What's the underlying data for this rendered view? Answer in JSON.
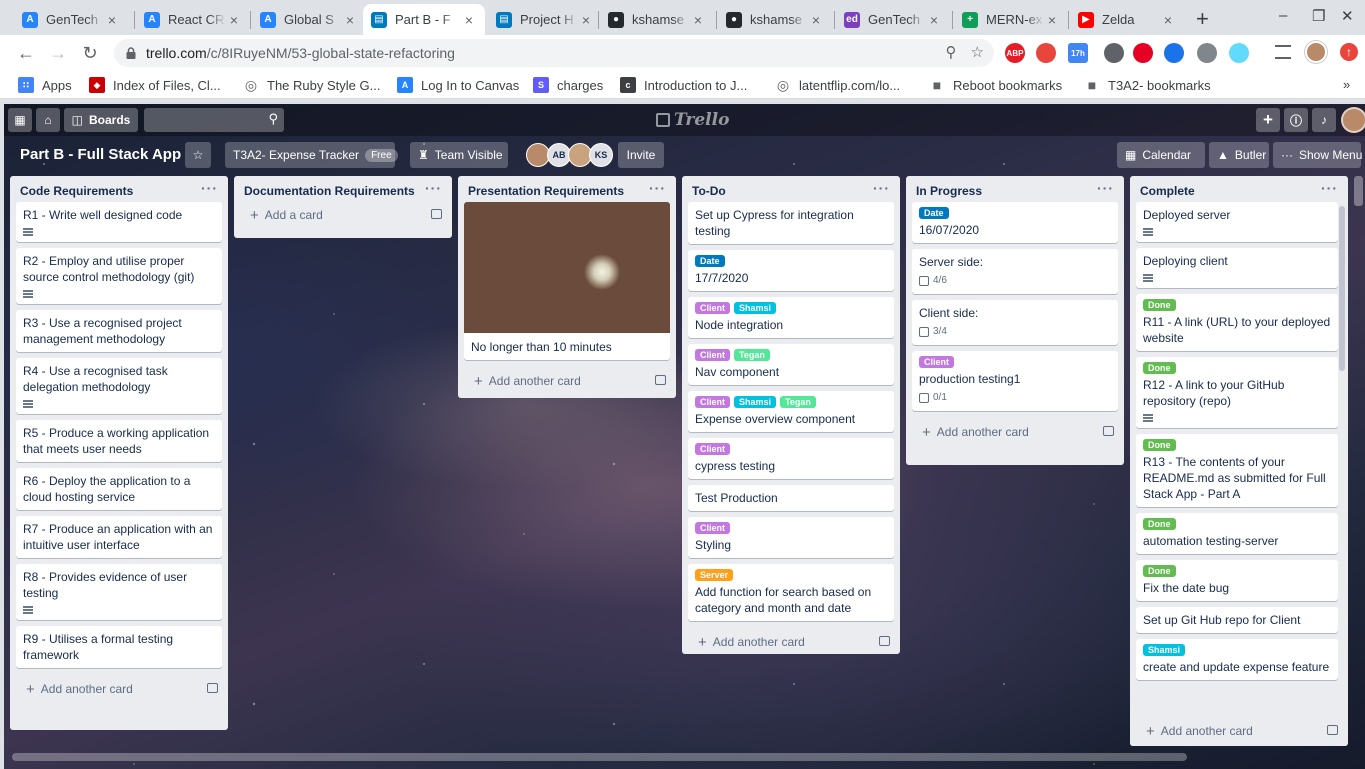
{
  "browser": {
    "tabs": [
      {
        "title": "GenTech",
        "icon": "atlassian-icon",
        "active": false
      },
      {
        "title": "React CR",
        "icon": "atlassian-icon",
        "active": false
      },
      {
        "title": "Global S",
        "icon": "atlassian-icon",
        "active": false
      },
      {
        "title": "Part B - F",
        "icon": "trello-icon",
        "active": true
      },
      {
        "title": "Project H",
        "icon": "trello-icon",
        "active": false
      },
      {
        "title": "kshamse",
        "icon": "github-icon",
        "active": false
      },
      {
        "title": "kshamse",
        "icon": "github-icon",
        "active": false
      },
      {
        "title": "GenTech",
        "icon": "ed-icon",
        "active": false
      },
      {
        "title": "MERN-ex",
        "icon": "sheets-icon",
        "active": false
      },
      {
        "title": "Zelda",
        "icon": "youtube-icon",
        "active": false
      }
    ],
    "url_host": "trello.com",
    "url_path": "/c/8IRuyeNM/53-global-state-refactoring",
    "extensions": [
      {
        "label": "ABP",
        "color": "#e41e26"
      },
      {
        "label": "",
        "color": "#e8453c"
      },
      {
        "label": "17h",
        "color": "#4285f4"
      },
      {
        "label": "",
        "color": "#5f6368"
      },
      {
        "label": "",
        "color": "#e60023"
      },
      {
        "label": "",
        "color": "#1a73e8"
      },
      {
        "label": "",
        "color": "#80868b"
      },
      {
        "label": "",
        "color": "#61dafb"
      }
    ],
    "bookmarks": [
      {
        "label": "Apps",
        "icon": "apps-icon"
      },
      {
        "label": "Index of Files, Cl...",
        "icon": "ruby-icon"
      },
      {
        "label": "The Ruby Style G...",
        "icon": "globe-icon"
      },
      {
        "label": "Log In to Canvas",
        "icon": "canvas-icon"
      },
      {
        "label": "charges",
        "icon": "stripe-icon"
      },
      {
        "label": "Introduction to J...",
        "icon": "doc-icon"
      },
      {
        "label": "latentflip.com/lo...",
        "icon": "globe-icon"
      },
      {
        "label": "Reboot bookmarks",
        "icon": "folder-icon"
      },
      {
        "label": "T3A2- bookmarks",
        "icon": "folder-icon"
      }
    ]
  },
  "board": {
    "header": {
      "boards_label": "Boards",
      "logo_text": "Trello"
    },
    "title": "Part B - Full Stack App",
    "team": "T3A2- Expense Tracker",
    "team_badge": "Free",
    "visibility": "Team Visible",
    "members": [
      "",
      "AB",
      "",
      "KS"
    ],
    "invite_label": "Invite",
    "calendar_label": "Calendar",
    "butler_label": "Butler",
    "menu_label": "Show Menu",
    "add_card_label": "Add another card",
    "add_card_first_label": "Add a card",
    "label_colors": {
      "Date": "#0079bf",
      "Client": "#c377e0",
      "Shamsi": "#00c2e0",
      "Tegan": "#51e898",
      "Server": "#ff9f1a",
      "Done": "#61bd4f"
    },
    "lists": [
      {
        "name": "Code Requirements",
        "cards": [
          {
            "text": "R1 - Write well designed code",
            "labels": [],
            "desc": true
          },
          {
            "text": "R2 - Employ and utilise proper source control methodology (git)",
            "labels": [],
            "desc": true
          },
          {
            "text": "R3 - Use a recognised project management methodology",
            "labels": [],
            "desc": false
          },
          {
            "text": "R4 - Use a recognised task delegation methodology",
            "labels": [],
            "desc": true
          },
          {
            "text": "R5 - Produce a working application that meets user needs",
            "labels": [],
            "desc": false
          },
          {
            "text": "R6 - Deploy the application to a cloud hosting service",
            "labels": [],
            "desc": false
          },
          {
            "text": "R7 - Produce an application with an intuitive user interface",
            "labels": [],
            "desc": false
          },
          {
            "text": "R8 - Provides evidence of user testing",
            "labels": [],
            "desc": true
          },
          {
            "text": "R9 - Utilises a formal testing framework",
            "labels": [],
            "desc": false
          }
        ],
        "footer": "Add another card"
      },
      {
        "name": "Documentation Requirements",
        "cards": [],
        "footer": "Add a card"
      },
      {
        "name": "Presentation Requirements",
        "cards": [
          {
            "text": "No longer than 10 minutes",
            "labels": [],
            "desc": false,
            "cover": "projector-image"
          }
        ],
        "footer": "Add another card"
      },
      {
        "name": "To-Do",
        "cards": [
          {
            "text": "Set up Cypress for integration testing",
            "labels": [],
            "desc": false
          },
          {
            "text": "17/7/2020",
            "labels": [
              "Date"
            ],
            "desc": false
          },
          {
            "text": "Node integration",
            "labels": [
              "Client",
              "Shamsi"
            ],
            "desc": false
          },
          {
            "text": "Nav component",
            "labels": [
              "Client",
              "Tegan"
            ],
            "desc": false
          },
          {
            "text": "Expense overview component",
            "labels": [
              "Client",
              "Shamsi",
              "Tegan"
            ],
            "desc": false
          },
          {
            "text": "cypress testing",
            "labels": [
              "Client"
            ],
            "desc": false
          },
          {
            "text": "Test Production",
            "labels": [],
            "desc": false
          },
          {
            "text": "Styling",
            "labels": [
              "Client"
            ],
            "desc": false
          },
          {
            "text": "Add function for search based on category and month and date",
            "labels": [
              "Server"
            ],
            "desc": false
          }
        ],
        "footer": "Add another card"
      },
      {
        "name": "In Progress",
        "cards": [
          {
            "text": "16/07/2020",
            "labels": [
              "Date"
            ],
            "desc": false
          },
          {
            "text": "Server side:",
            "labels": [],
            "desc": false,
            "checklist": "4/6"
          },
          {
            "text": "Client side:",
            "labels": [],
            "desc": false,
            "checklist": "3/4"
          },
          {
            "text": "production testing1",
            "labels": [
              "Client"
            ],
            "desc": false,
            "checklist": "0/1"
          }
        ],
        "footer": "Add another card"
      },
      {
        "name": "Complete",
        "cards": [
          {
            "text": "Deployed server",
            "labels": [],
            "desc": true
          },
          {
            "text": "Deploying client",
            "labels": [],
            "desc": true
          },
          {
            "text": "R11 - A link (URL) to your deployed website",
            "labels": [
              "Done"
            ],
            "desc": false
          },
          {
            "text": "R12 - A link to your GitHub repository (repo)",
            "labels": [
              "Done"
            ],
            "desc": true
          },
          {
            "text": "R13 - The contents of your README.md as submitted for Full Stack App - Part A",
            "labels": [
              "Done"
            ],
            "desc": false
          },
          {
            "text": "automation testing-server",
            "labels": [
              "Done"
            ],
            "desc": false
          },
          {
            "text": "Fix the date bug",
            "labels": [
              "Done"
            ],
            "desc": false
          },
          {
            "text": "Set up Git Hub repo for Client",
            "labels": [],
            "desc": false
          },
          {
            "text": "create and update expense feature",
            "labels": [
              "Shamsi"
            ],
            "desc": false
          }
        ],
        "footer": "Add another card"
      }
    ]
  }
}
